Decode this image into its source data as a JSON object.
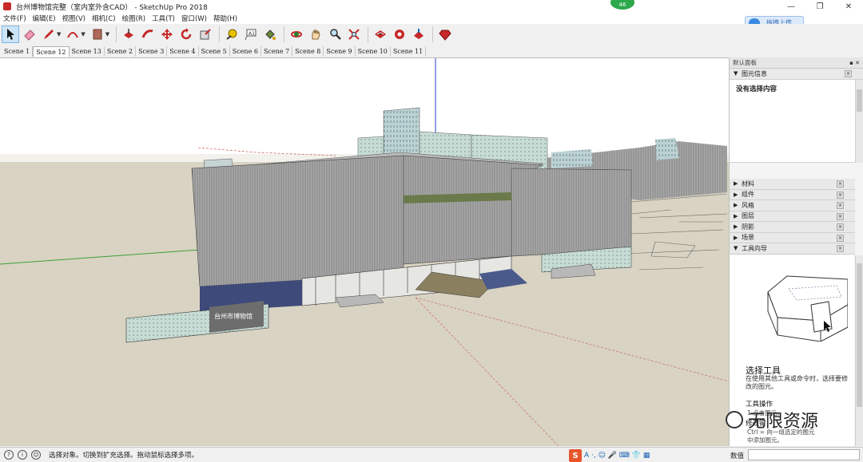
{
  "window": {
    "title": "台州博物馆完整（室内室外含CAD） - SketchUp Pro 2018",
    "badge": "46",
    "controls": {
      "minimize": "—",
      "restore": "❐",
      "close": "✕"
    }
  },
  "menu": [
    "文件(F)",
    "编辑(E)",
    "视图(V)",
    "相机(C)",
    "绘图(R)",
    "工具(T)",
    "窗口(W)",
    "帮助(H)"
  ],
  "upload_button": "拖拽上传",
  "toolbar": {
    "tools": [
      "select-icon",
      "eraser-icon",
      "pencil-icon",
      "arc-icon",
      "rectangle-icon",
      "pushpull-icon",
      "followme-icon",
      "move-icon",
      "rotate-icon",
      "scale-icon",
      "tape-measure-icon",
      "text-icon",
      "paint-bucket-icon",
      "orbit-icon",
      "pan-icon",
      "zoom-icon",
      "zoom-extents-icon",
      "warehouse-icon",
      "extension-icon",
      "share-model-icon",
      "ruby-icon"
    ],
    "accent": "#c62828"
  },
  "scenes": [
    "Scene 1",
    "Scene 12",
    "Scene 13",
    "Scene 2",
    "Scene 3",
    "Scene 4",
    "Scene 5",
    "Scene 6",
    "Scene 7",
    "Scene 8",
    "Scene 9",
    "Scene 10",
    "Scene 11"
  ],
  "active_scene": "Scene 12",
  "tray": {
    "title": "默认面板",
    "entity_info": {
      "label": "图元信息",
      "content": "没有选择内容"
    },
    "panels": [
      "材料",
      "组件",
      "风格",
      "图层",
      "阴影",
      "场景",
      "工具向导"
    ],
    "instructor": {
      "title": "选择工具",
      "description": "在使用其他工具或命令时，选择要修改的图元。",
      "operations_heading": "工具操作",
      "step1": "1.点击图元。",
      "modifier_heading": "修改键",
      "step2": "Ctrl = 向一组选定的图元",
      "step3": "中添加图元。"
    }
  },
  "model_sign_text": "台州市博物馆",
  "watermark": "无限资源",
  "status": {
    "message": "选择对象。切换到扩充选择。拖动鼠标选择多项。",
    "measurements_label": "数值",
    "ime_logo": "S",
    "ime_icons": "A ⋅, ☺ 🎤 ⌨ 👕 ▦"
  }
}
